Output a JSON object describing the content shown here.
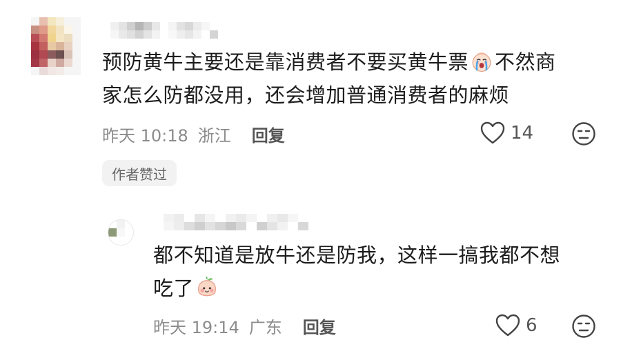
{
  "comment": {
    "text_line1": "预防黄牛主要还是靠消费者不要买黄牛票",
    "text_line1_after": "不然商",
    "text_line2": "家怎么防都没用，还会增加普通消费者的麻烦",
    "emoji_icon": "crying-face-emoji",
    "time": "昨天 10:18",
    "location": "浙江",
    "reply_label": "回复",
    "likes": "14",
    "badge": "作者赞过"
  },
  "reply": {
    "text_line1": "都不知道是放牛还是防我，这样一搞我都不想",
    "text_line2": "吃了",
    "emoji_icon": "peach-smile-emoji",
    "time": "昨天 19:14",
    "location": "广东",
    "reply_label": "回复",
    "likes": "6"
  },
  "icons": {
    "heart": "heart-outline-icon",
    "dislike": "meh-face-icon"
  },
  "colors": {
    "text": "#1c1c1c",
    "meta": "#8c8c8c",
    "badge_bg": "#f2f2f2"
  },
  "mosaic": {
    "avatar_main": [
      "#f5f5f5",
      "#e8c0b0",
      "#f3e6c0",
      "#f6efdc",
      "#f5f5f5",
      "#f5f5f5",
      "#c79080",
      "#e09a88",
      "#f1d79c",
      "#f2e4c2",
      "#fbf5ea",
      "#f5f5f5",
      "#b84e55",
      "#d27a72",
      "#f0d48e",
      "#f4e6c5",
      "#ecdcc0",
      "#f5f5f5",
      "#a8343f",
      "#c45f60",
      "#e7c9a4",
      "#d9b49a",
      "#e8d1c0",
      "#f5f5f5",
      "#9c3040",
      "#b04952",
      "#8c5b5d",
      "#6d5050",
      "#d9c3b7",
      "#f5f5f5",
      "#a23647",
      "#c06468",
      "#e8d2c8",
      "#cfa9a0",
      "#ebd9d0",
      "#f5f5f5",
      "#f5f5f5",
      "#eadada",
      "#f1e7e4",
      "#f3ebe8",
      "#f5f5f5",
      "#f5f5f5"
    ],
    "name_main": [
      "#ffffff",
      "#f0f0f0",
      "#e3e3e3",
      "#cfcfcf",
      "#b5b5b5",
      "#cccccc",
      "#e8e8e8",
      "#ffffff",
      "#f4f4f4",
      "#e2e2e2",
      "#d8d8d8",
      "#ececec",
      "#f6f6f6",
      "#ffffff",
      "#ffffff",
      "#ffffff",
      "#ffffff",
      "#f6f6f6",
      "#e9e9e9",
      "#e0e0e0",
      "#d2d2d2",
      "#e4e4e4",
      "#f3f3f3",
      "#ffffff",
      "#f8f8f8",
      "#eeeeee",
      "#e6e6e6",
      "#f3f3f3",
      "#ffffff",
      "#d4d4d4",
      "#ffffff",
      "#ffffff"
    ],
    "avatar_reply": [
      "#ffffff",
      "#f2f2f2",
      "#ffffff",
      "#8c9a78",
      "#f7f7f7",
      "#ffffff",
      "#ffffff",
      "#ffffff",
      "#ffffff"
    ],
    "name_reply": [
      "#ffffff",
      "#f2f2f2",
      "#ececec",
      "#ffffff",
      "#e6e6e6",
      "#f5f5f5",
      "#ffffff",
      "#f1f1f1",
      "#eaeaea",
      "#f4f4f4",
      "#ffffff",
      "#f0f0f0",
      "#e8e8e8",
      "#f6f6f6",
      "#ffffff",
      "#ffffff",
      "#ffffff",
      "#ffffff",
      "#ffffff",
      "#f5f5f5",
      "#ededed",
      "#dddddd",
      "#cfcfcf",
      "#e2e2e2",
      "#d6d6d6",
      "#c8c8c8",
      "#d9d9d9",
      "#ffffff",
      "#d0d0d0",
      "#e4e4e4",
      "#f2f2f2",
      "#ffffff",
      "#d8d8d8",
      "#ffffff",
      "#ffffff",
      "#ffffff"
    ]
  }
}
